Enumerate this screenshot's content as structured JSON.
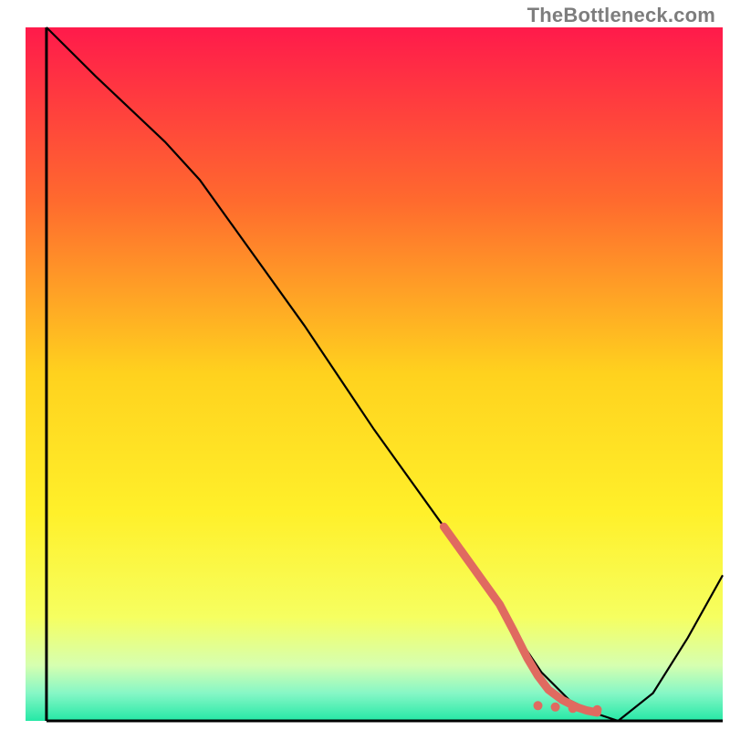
{
  "watermark": "TheBottleneck.com",
  "chart_data": {
    "type": "line",
    "title": "",
    "xlabel": "",
    "ylabel": "",
    "xlim": [
      0,
      100
    ],
    "ylim": [
      0,
      100
    ],
    "background_gradient": {
      "stops": [
        {
          "offset": 0,
          "color": "#ff1a4b"
        },
        {
          "offset": 0.25,
          "color": "#ff6a2e"
        },
        {
          "offset": 0.5,
          "color": "#ffd21e"
        },
        {
          "offset": 0.7,
          "color": "#fff02a"
        },
        {
          "offset": 0.85,
          "color": "#f6ff60"
        },
        {
          "offset": 0.92,
          "color": "#d6ffb0"
        },
        {
          "offset": 0.96,
          "color": "#86f7c6"
        },
        {
          "offset": 1.0,
          "color": "#25e8a6"
        }
      ]
    },
    "series": [
      {
        "name": "bottleneck-curve",
        "color": "#000000",
        "x": [
          3,
          10,
          20,
          25,
          30,
          40,
          50,
          60,
          65,
          70,
          74,
          78,
          82,
          85,
          90,
          95,
          100
        ],
        "y": [
          100,
          93,
          83.5,
          78,
          71,
          57,
          42,
          28,
          21,
          13,
          7,
          3,
          1,
          0,
          4,
          12,
          21
        ]
      }
    ],
    "highlight_segment": {
      "name": "selected-range",
      "color": "#e06a60",
      "thickness": 9,
      "x": [
        60,
        62,
        64,
        66,
        68,
        70,
        72,
        73.5,
        75,
        77,
        79,
        80.5,
        82
      ],
      "y": [
        28,
        25.2,
        22.4,
        19.6,
        16.8,
        13,
        9,
        6.5,
        4.5,
        3,
        2,
        1.5,
        1.2
      ]
    },
    "highlight_points": {
      "name": "selected-marks",
      "color": "#e06a60",
      "radius": 5,
      "points": [
        {
          "x": 73.5,
          "y": 2.2
        },
        {
          "x": 76,
          "y": 2.0
        },
        {
          "x": 78.5,
          "y": 1.8
        },
        {
          "x": 82,
          "y": 1.6
        }
      ]
    },
    "axes": {
      "left": {
        "x": 3,
        "y0": 0,
        "y1": 100
      },
      "bottom": {
        "y": 0,
        "x0": 3,
        "x1": 100
      }
    }
  }
}
